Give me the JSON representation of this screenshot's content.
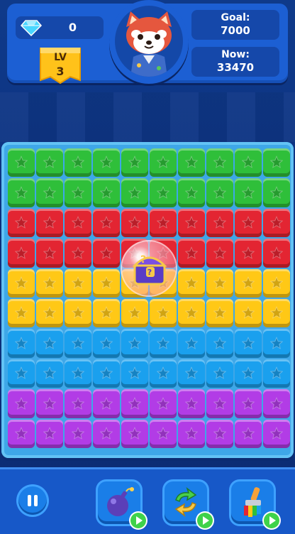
{
  "header": {
    "gems": {
      "icon": "diamond-icon",
      "count": "0"
    },
    "level": {
      "label": "LV",
      "number": "3"
    },
    "avatar": {
      "icon": "red-panda-avatar-icon"
    },
    "goal": {
      "label": "Goal:",
      "value": "7000"
    },
    "now": {
      "label": "Now:",
      "value": "33470"
    }
  },
  "board": {
    "columns": 10,
    "rows": [
      "green",
      "green",
      "red",
      "red",
      "yellow",
      "yellow",
      "blue",
      "blue",
      "purple",
      "purple"
    ],
    "colors": {
      "green": "#2fbf3a",
      "red": "#e32532",
      "yellow": "#ffc816",
      "blue": "#1aa0ee",
      "purple": "#b23ce6"
    },
    "bubble_item": {
      "icon": "treasure-chest-bubble-icon"
    }
  },
  "bottom_bar": {
    "pause": {
      "icon": "pause-icon"
    },
    "tools": [
      {
        "name": "bomb",
        "icon": "bomb-icon",
        "badge": "play-icon"
      },
      {
        "name": "shuffle",
        "icon": "shuffle-icon",
        "badge": "play-icon"
      },
      {
        "name": "paint-brush",
        "icon": "paint-brush-icon",
        "badge": "play-icon"
      }
    ]
  }
}
